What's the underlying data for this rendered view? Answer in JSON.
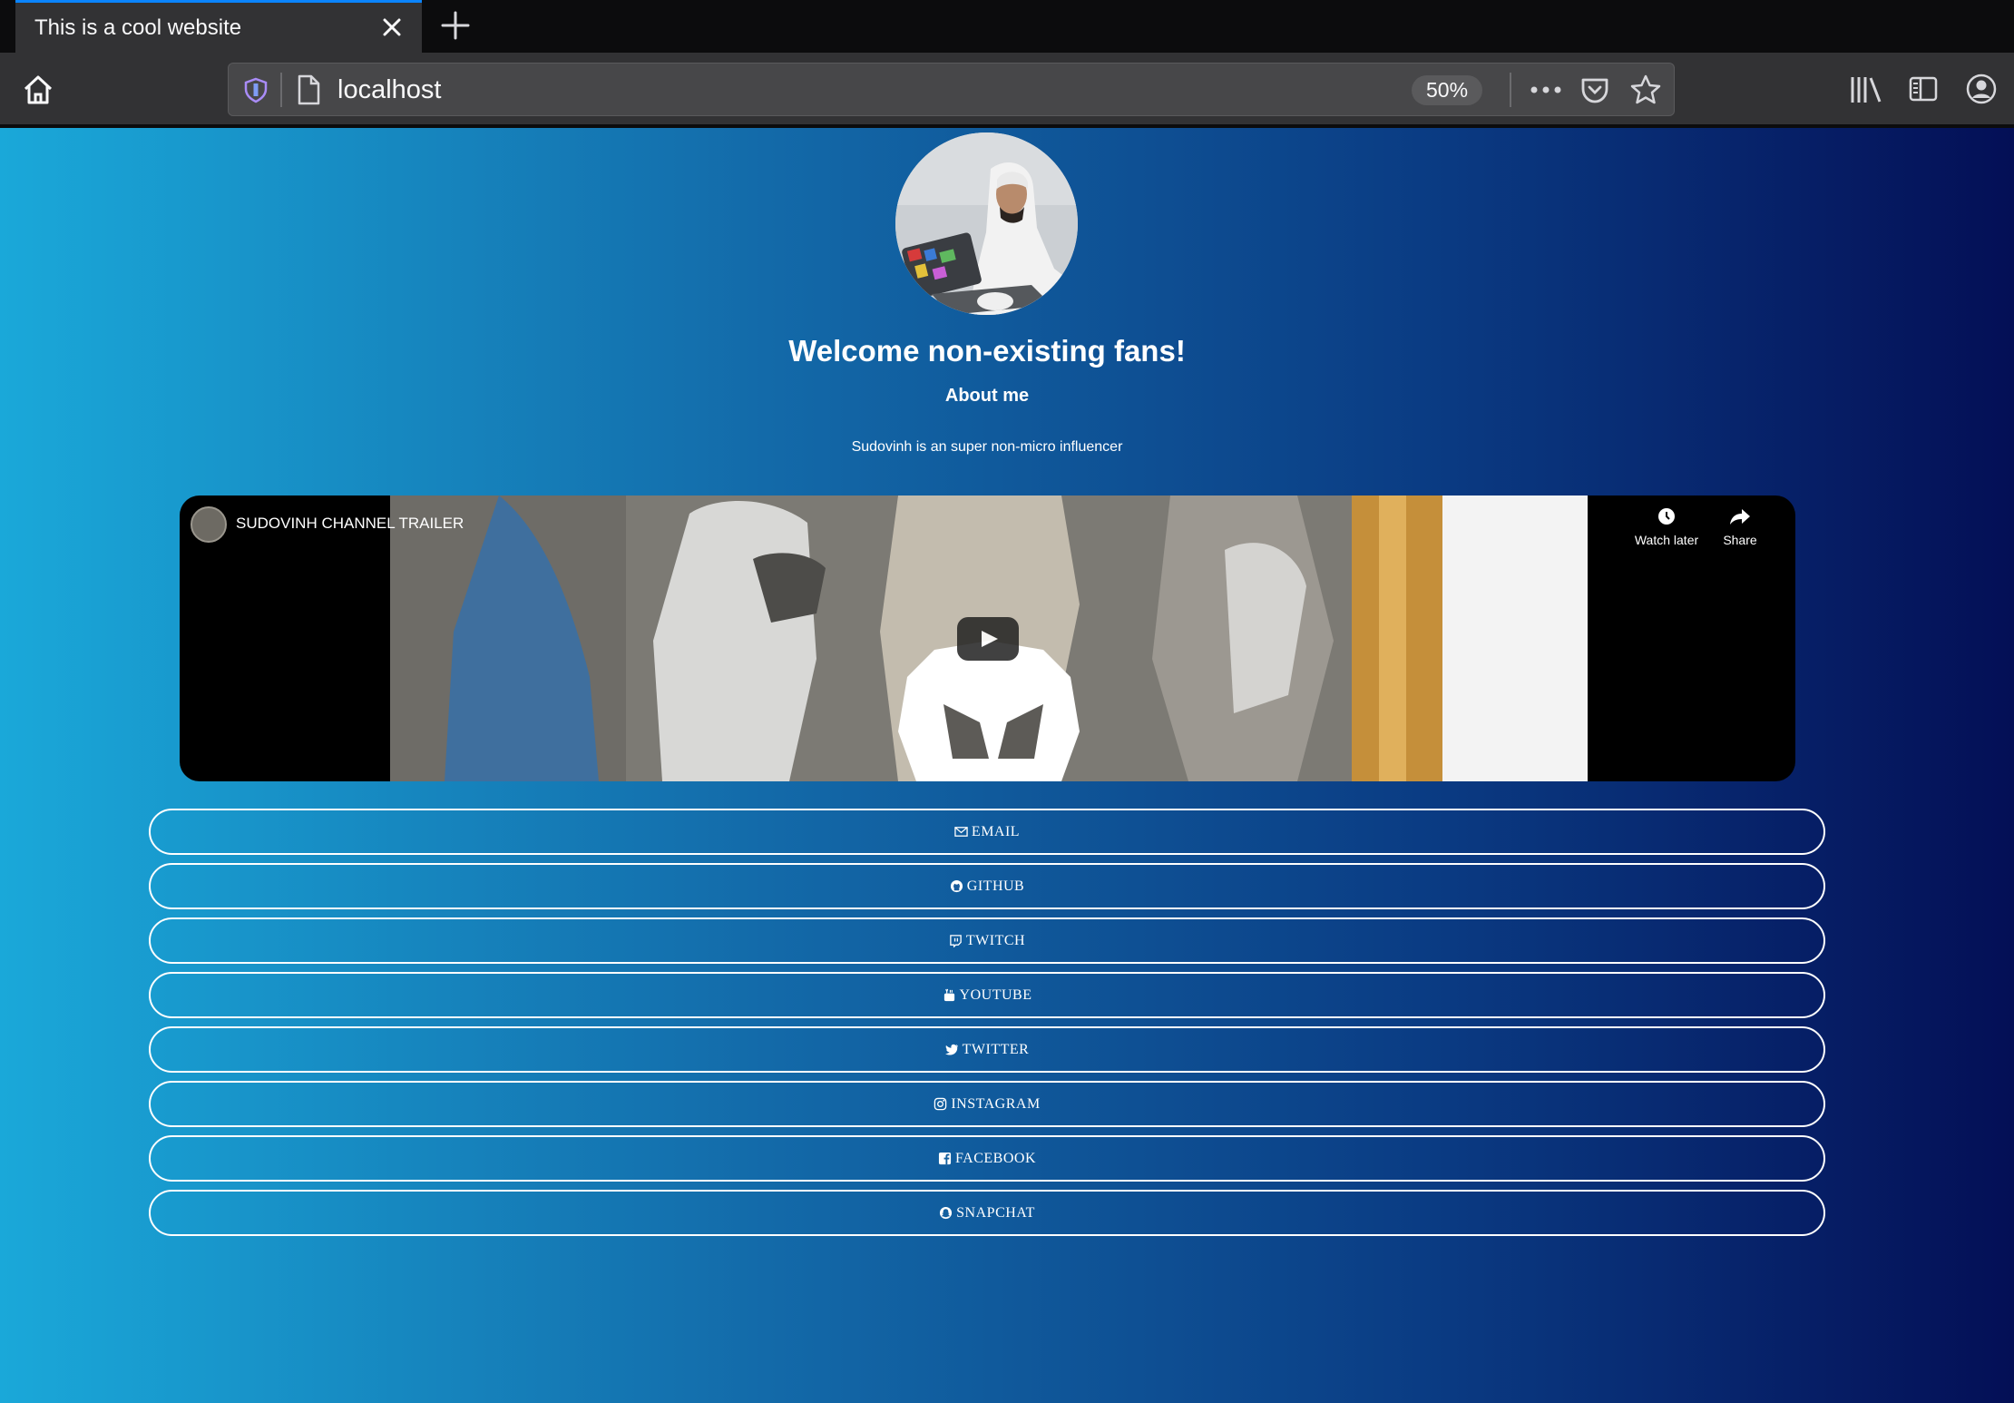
{
  "browser": {
    "tab_title": "This is a cool website",
    "url": "localhost",
    "zoom": "50%"
  },
  "page": {
    "heading": "Welcome non-existing fans!",
    "about_title": "About me",
    "bio": "Sudovinh is an super non-micro influencer",
    "colors": {
      "gradient_start": "#1aa8d9",
      "gradient_end": "#040f56",
      "text": "#ffffff"
    }
  },
  "video": {
    "title": "SUDOVINH CHANNEL TRAILER",
    "watch_later_label": "Watch later",
    "share_label": "Share"
  },
  "links": [
    {
      "label": "EMAIL",
      "icon": "envelope-icon"
    },
    {
      "label": "GITHUB",
      "icon": "github-icon"
    },
    {
      "label": "TWITCH",
      "icon": "twitch-icon"
    },
    {
      "label": "YOUTUBE",
      "icon": "youtube-icon"
    },
    {
      "label": "TWITTER",
      "icon": "twitter-icon"
    },
    {
      "label": "INSTAGRAM",
      "icon": "instagram-icon"
    },
    {
      "label": "FACEBOOK",
      "icon": "facebook-icon"
    },
    {
      "label": "SNAPCHAT",
      "icon": "snapchat-icon"
    }
  ]
}
